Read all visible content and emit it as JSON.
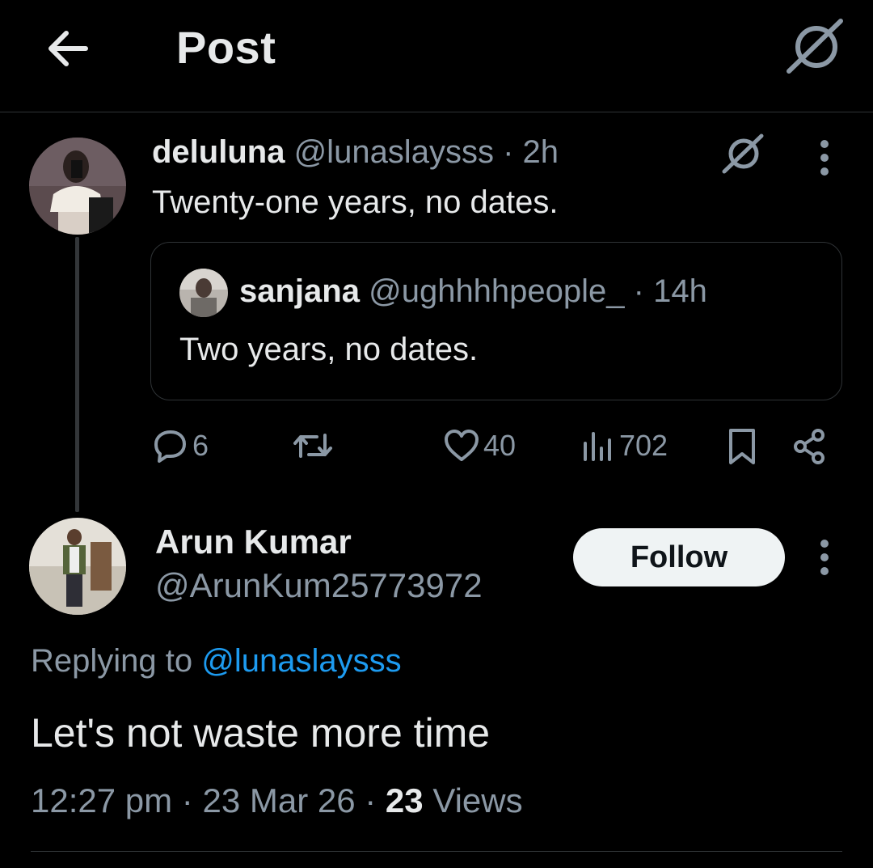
{
  "header": {
    "title": "Post",
    "back_icon": "arrow-left-icon",
    "grok_icon": "grok-icon"
  },
  "parent_post": {
    "display_name": "deluluna",
    "handle": "@lunaslaysss",
    "time": "· 2h",
    "text": "Twenty-one years, no dates.",
    "quoted_post": {
      "display_name": "sanjana",
      "handle": "@ughhhhpeople_",
      "time": "· 14h",
      "text": "Two years, no dates."
    },
    "actions": {
      "replies": "6",
      "reposts": "",
      "likes": "40",
      "views": "702"
    }
  },
  "reply_post": {
    "display_name": "Arun Kumar",
    "handle": "@ArunKum25773972",
    "follow_label": "Follow",
    "replying_prefix": "Replying to",
    "replying_to": "@lunaslaysss",
    "text": "Let's not waste more time",
    "time": "12:27 pm",
    "date": "23 Mar 26",
    "views_count": "23",
    "views_label": "Views"
  },
  "colors": {
    "background": "#000000",
    "text_primary": "#e7e9ea",
    "text_secondary": "#8b98a5",
    "link": "#1d9bf0",
    "border": "#2f3336"
  }
}
